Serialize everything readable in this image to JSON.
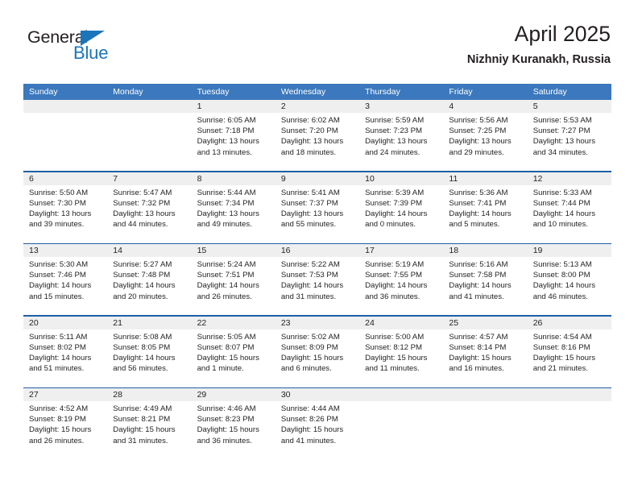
{
  "brand": {
    "name_part1": "General",
    "name_part2": "Blue",
    "triangle_icon": "triangle-icon",
    "accent_color": "#1b75bb"
  },
  "header": {
    "title": "April 2025",
    "subtitle": "Nizhniy Kuranakh, Russia"
  },
  "colors": {
    "weekday_header_bg": "#3b78bd",
    "week_rule": "#1f5fa6",
    "daynum_band_bg": "#efeff0",
    "text": "#231f20"
  },
  "calendar": {
    "weekdays": [
      "Sunday",
      "Monday",
      "Tuesday",
      "Wednesday",
      "Thursday",
      "Friday",
      "Saturday"
    ],
    "weeks": [
      {
        "days": [
          {
            "num": "",
            "sunrise": "",
            "sunset": "",
            "daylight1": "",
            "daylight2": ""
          },
          {
            "num": "",
            "sunrise": "",
            "sunset": "",
            "daylight1": "",
            "daylight2": ""
          },
          {
            "num": "1",
            "sunrise": "Sunrise: 6:05 AM",
            "sunset": "Sunset: 7:18 PM",
            "daylight1": "Daylight: 13 hours",
            "daylight2": "and 13 minutes."
          },
          {
            "num": "2",
            "sunrise": "Sunrise: 6:02 AM",
            "sunset": "Sunset: 7:20 PM",
            "daylight1": "Daylight: 13 hours",
            "daylight2": "and 18 minutes."
          },
          {
            "num": "3",
            "sunrise": "Sunrise: 5:59 AM",
            "sunset": "Sunset: 7:23 PM",
            "daylight1": "Daylight: 13 hours",
            "daylight2": "and 24 minutes."
          },
          {
            "num": "4",
            "sunrise": "Sunrise: 5:56 AM",
            "sunset": "Sunset: 7:25 PM",
            "daylight1": "Daylight: 13 hours",
            "daylight2": "and 29 minutes."
          },
          {
            "num": "5",
            "sunrise": "Sunrise: 5:53 AM",
            "sunset": "Sunset: 7:27 PM",
            "daylight1": "Daylight: 13 hours",
            "daylight2": "and 34 minutes."
          }
        ]
      },
      {
        "days": [
          {
            "num": "6",
            "sunrise": "Sunrise: 5:50 AM",
            "sunset": "Sunset: 7:30 PM",
            "daylight1": "Daylight: 13 hours",
            "daylight2": "and 39 minutes."
          },
          {
            "num": "7",
            "sunrise": "Sunrise: 5:47 AM",
            "sunset": "Sunset: 7:32 PM",
            "daylight1": "Daylight: 13 hours",
            "daylight2": "and 44 minutes."
          },
          {
            "num": "8",
            "sunrise": "Sunrise: 5:44 AM",
            "sunset": "Sunset: 7:34 PM",
            "daylight1": "Daylight: 13 hours",
            "daylight2": "and 49 minutes."
          },
          {
            "num": "9",
            "sunrise": "Sunrise: 5:41 AM",
            "sunset": "Sunset: 7:37 PM",
            "daylight1": "Daylight: 13 hours",
            "daylight2": "and 55 minutes."
          },
          {
            "num": "10",
            "sunrise": "Sunrise: 5:39 AM",
            "sunset": "Sunset: 7:39 PM",
            "daylight1": "Daylight: 14 hours",
            "daylight2": "and 0 minutes."
          },
          {
            "num": "11",
            "sunrise": "Sunrise: 5:36 AM",
            "sunset": "Sunset: 7:41 PM",
            "daylight1": "Daylight: 14 hours",
            "daylight2": "and 5 minutes."
          },
          {
            "num": "12",
            "sunrise": "Sunrise: 5:33 AM",
            "sunset": "Sunset: 7:44 PM",
            "daylight1": "Daylight: 14 hours",
            "daylight2": "and 10 minutes."
          }
        ]
      },
      {
        "days": [
          {
            "num": "13",
            "sunrise": "Sunrise: 5:30 AM",
            "sunset": "Sunset: 7:46 PM",
            "daylight1": "Daylight: 14 hours",
            "daylight2": "and 15 minutes."
          },
          {
            "num": "14",
            "sunrise": "Sunrise: 5:27 AM",
            "sunset": "Sunset: 7:48 PM",
            "daylight1": "Daylight: 14 hours",
            "daylight2": "and 20 minutes."
          },
          {
            "num": "15",
            "sunrise": "Sunrise: 5:24 AM",
            "sunset": "Sunset: 7:51 PM",
            "daylight1": "Daylight: 14 hours",
            "daylight2": "and 26 minutes."
          },
          {
            "num": "16",
            "sunrise": "Sunrise: 5:22 AM",
            "sunset": "Sunset: 7:53 PM",
            "daylight1": "Daylight: 14 hours",
            "daylight2": "and 31 minutes."
          },
          {
            "num": "17",
            "sunrise": "Sunrise: 5:19 AM",
            "sunset": "Sunset: 7:55 PM",
            "daylight1": "Daylight: 14 hours",
            "daylight2": "and 36 minutes."
          },
          {
            "num": "18",
            "sunrise": "Sunrise: 5:16 AM",
            "sunset": "Sunset: 7:58 PM",
            "daylight1": "Daylight: 14 hours",
            "daylight2": "and 41 minutes."
          },
          {
            "num": "19",
            "sunrise": "Sunrise: 5:13 AM",
            "sunset": "Sunset: 8:00 PM",
            "daylight1": "Daylight: 14 hours",
            "daylight2": "and 46 minutes."
          }
        ]
      },
      {
        "days": [
          {
            "num": "20",
            "sunrise": "Sunrise: 5:11 AM",
            "sunset": "Sunset: 8:02 PM",
            "daylight1": "Daylight: 14 hours",
            "daylight2": "and 51 minutes."
          },
          {
            "num": "21",
            "sunrise": "Sunrise: 5:08 AM",
            "sunset": "Sunset: 8:05 PM",
            "daylight1": "Daylight: 14 hours",
            "daylight2": "and 56 minutes."
          },
          {
            "num": "22",
            "sunrise": "Sunrise: 5:05 AM",
            "sunset": "Sunset: 8:07 PM",
            "daylight1": "Daylight: 15 hours",
            "daylight2": "and 1 minute."
          },
          {
            "num": "23",
            "sunrise": "Sunrise: 5:02 AM",
            "sunset": "Sunset: 8:09 PM",
            "daylight1": "Daylight: 15 hours",
            "daylight2": "and 6 minutes."
          },
          {
            "num": "24",
            "sunrise": "Sunrise: 5:00 AM",
            "sunset": "Sunset: 8:12 PM",
            "daylight1": "Daylight: 15 hours",
            "daylight2": "and 11 minutes."
          },
          {
            "num": "25",
            "sunrise": "Sunrise: 4:57 AM",
            "sunset": "Sunset: 8:14 PM",
            "daylight1": "Daylight: 15 hours",
            "daylight2": "and 16 minutes."
          },
          {
            "num": "26",
            "sunrise": "Sunrise: 4:54 AM",
            "sunset": "Sunset: 8:16 PM",
            "daylight1": "Daylight: 15 hours",
            "daylight2": "and 21 minutes."
          }
        ]
      },
      {
        "days": [
          {
            "num": "27",
            "sunrise": "Sunrise: 4:52 AM",
            "sunset": "Sunset: 8:19 PM",
            "daylight1": "Daylight: 15 hours",
            "daylight2": "and 26 minutes."
          },
          {
            "num": "28",
            "sunrise": "Sunrise: 4:49 AM",
            "sunset": "Sunset: 8:21 PM",
            "daylight1": "Daylight: 15 hours",
            "daylight2": "and 31 minutes."
          },
          {
            "num": "29",
            "sunrise": "Sunrise: 4:46 AM",
            "sunset": "Sunset: 8:23 PM",
            "daylight1": "Daylight: 15 hours",
            "daylight2": "and 36 minutes."
          },
          {
            "num": "30",
            "sunrise": "Sunrise: 4:44 AM",
            "sunset": "Sunset: 8:26 PM",
            "daylight1": "Daylight: 15 hours",
            "daylight2": "and 41 minutes."
          },
          {
            "num": "",
            "sunrise": "",
            "sunset": "",
            "daylight1": "",
            "daylight2": ""
          },
          {
            "num": "",
            "sunrise": "",
            "sunset": "",
            "daylight1": "",
            "daylight2": ""
          },
          {
            "num": "",
            "sunrise": "",
            "sunset": "",
            "daylight1": "",
            "daylight2": ""
          }
        ]
      }
    ]
  }
}
